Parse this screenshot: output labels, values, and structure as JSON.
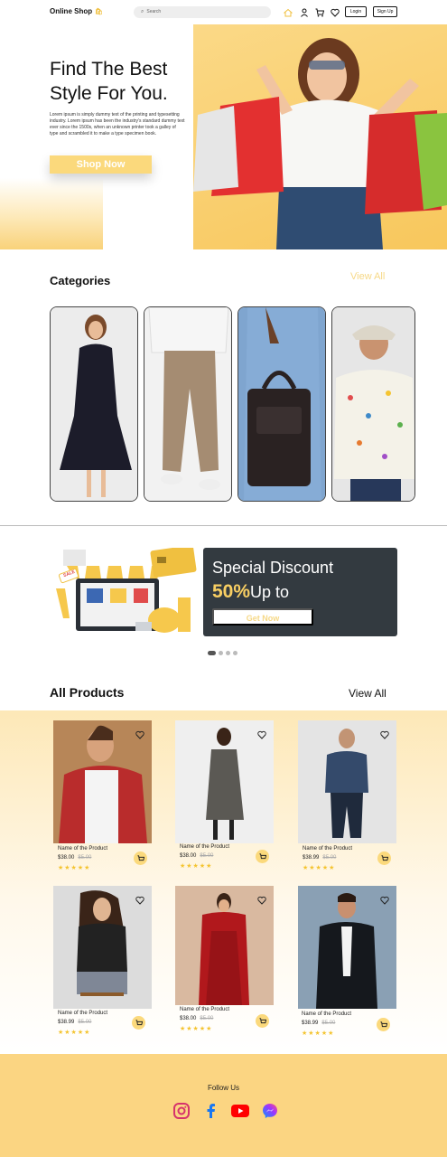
{
  "header": {
    "logo": "Online Shop",
    "search_placeholder": "Search",
    "login_label": "Login",
    "signup_label": "Sign Up"
  },
  "hero": {
    "title_line1": "Find The Best",
    "title_line2": "Style For You.",
    "body": "Lorem ipsum is simply dummy text of the printing and typesetting industry. Lorem ipsum has been the industry's standard dummy text ever since the 1500s, when an unknown printer took a galley of type and scrambled it to make a type specimen book.",
    "cta_label": "Shop Now"
  },
  "categories": {
    "title": "Categories",
    "view_all": "View All"
  },
  "banner": {
    "title": "Special Discount",
    "percent": "50%",
    "suffix": "Up to",
    "cta_label": "Get Now",
    "sale_tag": "SALE"
  },
  "products": {
    "title": "All Products",
    "view_all": "View All",
    "items": [
      {
        "name": "Name of the Product",
        "price": "$38.00",
        "old_price": "$5.00",
        "stars": "★★★★★"
      },
      {
        "name": "Name of the Product",
        "price": "$38.00",
        "old_price": "$5.00",
        "stars": "★★★★★"
      },
      {
        "name": "Name of the Product",
        "price": "$38.99",
        "old_price": "$5.00",
        "stars": "★★★★★"
      },
      {
        "name": "Name of the Product",
        "price": "$38.99",
        "old_price": "$5.00",
        "stars": "★★★★★"
      },
      {
        "name": "Name of the Product",
        "price": "$38.00",
        "old_price": "$5.00",
        "stars": "★★★★★"
      },
      {
        "name": "Name of the Product",
        "price": "$38.99",
        "old_price": "$5.00",
        "stars": "★★★★★"
      }
    ]
  },
  "footer": {
    "follow_label": "Follow Us",
    "social_icons": [
      "instagram-icon",
      "facebook-icon",
      "youtube-icon",
      "messenger-icon"
    ]
  },
  "colors": {
    "accent": "#fbd97c",
    "dark_banner": "#333a40",
    "star": "#f4c430"
  }
}
